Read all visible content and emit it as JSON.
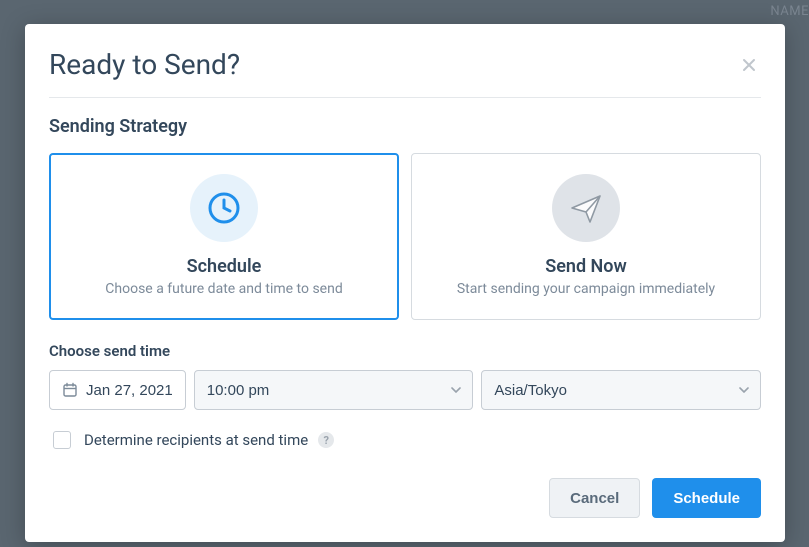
{
  "background_label": "NAME",
  "modal": {
    "title": "Ready to Send?",
    "section_title": "Sending Strategy",
    "cards": {
      "schedule": {
        "title": "Schedule",
        "subtitle": "Choose a future date and time to send",
        "selected": true
      },
      "send_now": {
        "title": "Send Now",
        "subtitle": "Start sending your campaign immediately",
        "selected": false
      }
    },
    "send_time": {
      "label": "Choose send time",
      "date": "Jan 27, 2021",
      "time": "10:00 pm",
      "timezone": "Asia/Tokyo"
    },
    "checkbox": {
      "label": "Determine recipients at send time",
      "checked": false
    },
    "footer": {
      "cancel": "Cancel",
      "submit": "Schedule"
    }
  }
}
